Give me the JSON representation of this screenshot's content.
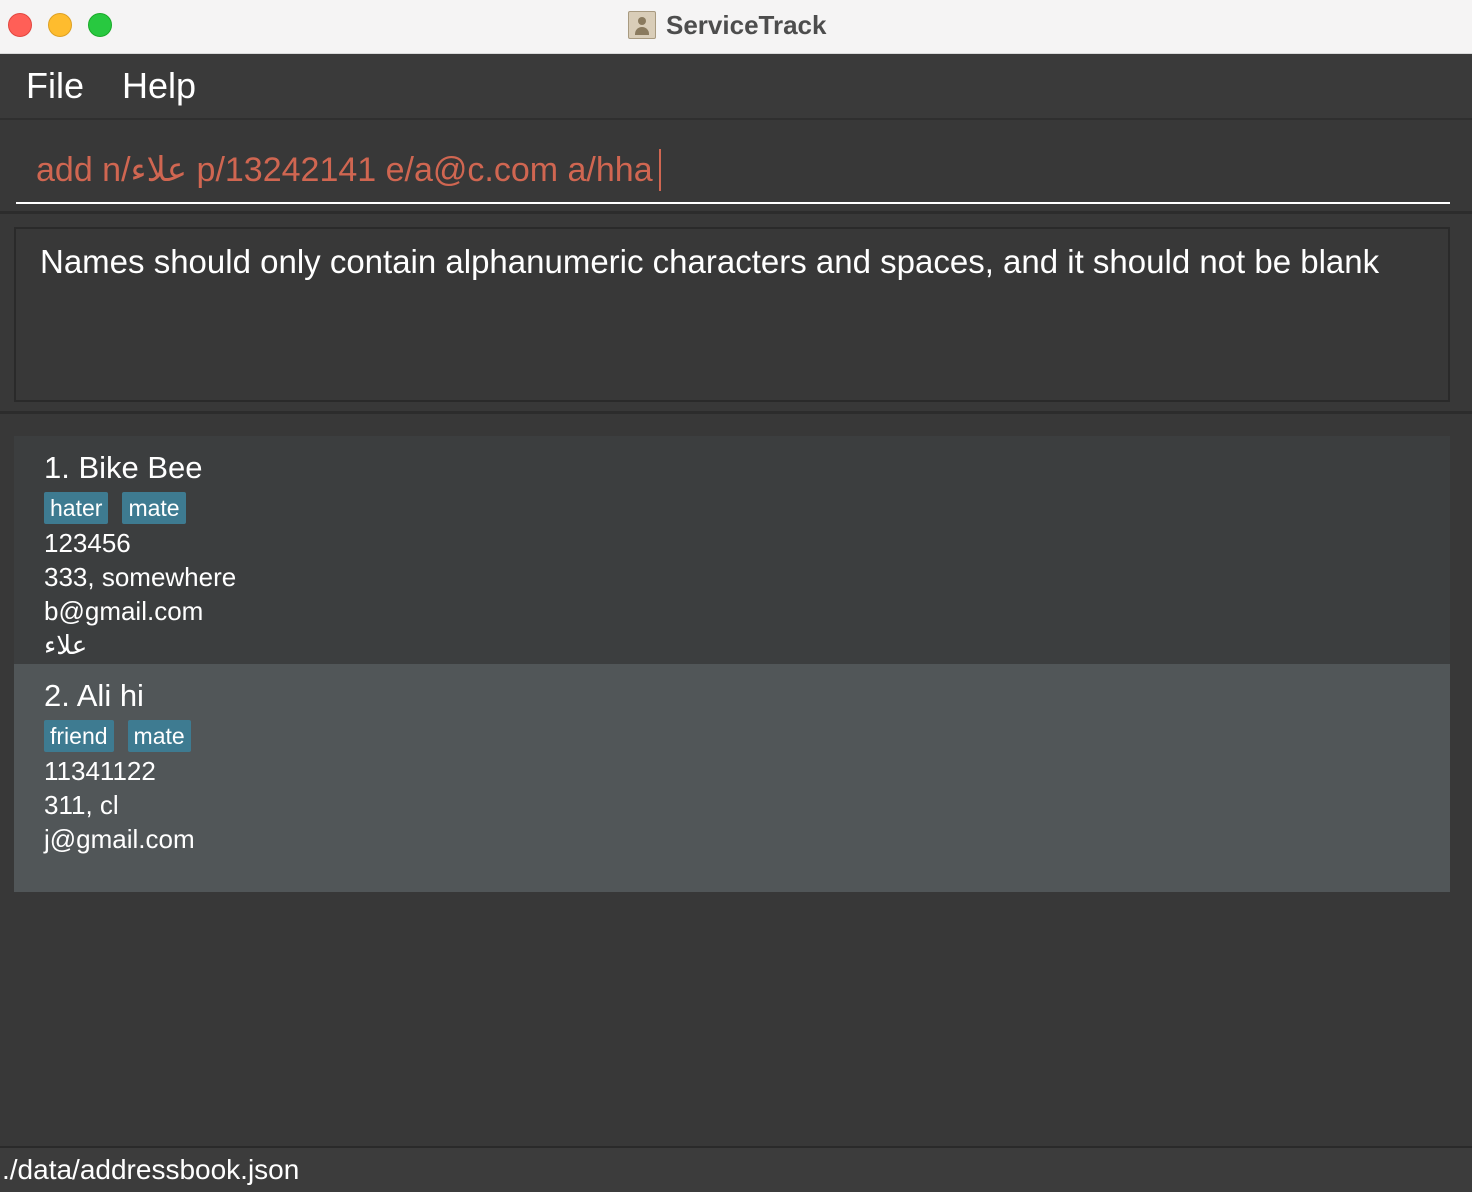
{
  "window": {
    "title": "ServiceTrack",
    "icon": "address-book-icon"
  },
  "menu": {
    "file_label": "File",
    "help_label": "Help"
  },
  "command": {
    "value": "add n/علاء p/13242141 e/a@c.com a/hha"
  },
  "result": {
    "message": "Names should only contain alphanumeric characters and spaces, and it should not be blank"
  },
  "persons": [
    {
      "name": "1. Bike Bee",
      "tags": [
        "hater",
        "mate"
      ],
      "phone": "123456",
      "address": "333, somewhere",
      "email": "b@gmail.com",
      "extra": "علاء"
    },
    {
      "name": "2. Ali hi",
      "tags": [
        "friend",
        "mate"
      ],
      "phone": "11341122",
      "address": "311, cl",
      "email": "j@gmail.com",
      "extra": ""
    }
  ],
  "status": {
    "file_path": "./data/addressbook.json"
  },
  "colors": {
    "background": "#383838",
    "command_text": "#d06651",
    "tag": "#3e7b91",
    "card_odd": "#3c3e3f",
    "card_even": "#515658"
  }
}
